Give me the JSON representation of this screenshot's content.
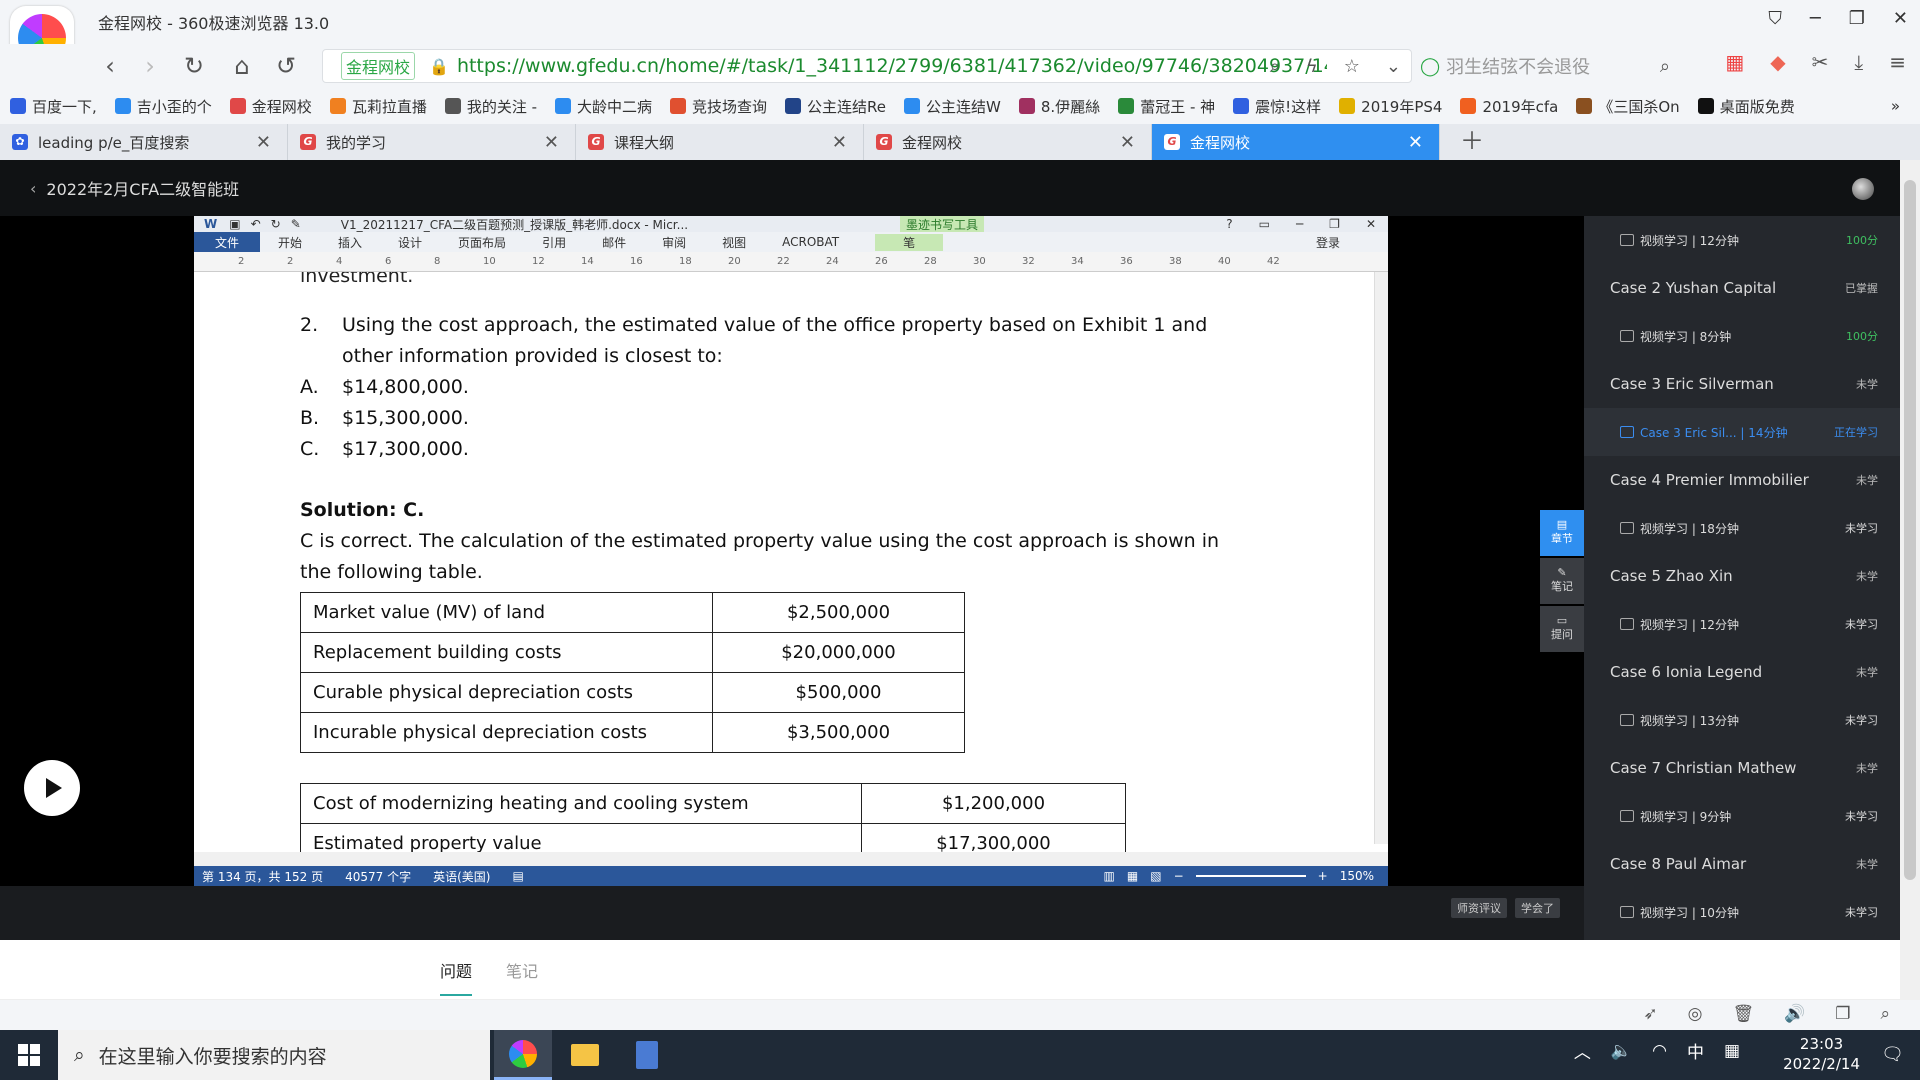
{
  "browser": {
    "window_title": "金程网校 - 360极速浏览器 13.0",
    "url_tag": "金程网校",
    "url": "https://www.gfedu.cn/home/#/task/1_341112/2799/6381/417362/video/97746/38204937/14",
    "search_placeholder": "羽生结弦不会退役",
    "bookmarks": [
      "百度一下,",
      "吉小歪的个",
      "金程网校",
      "瓦莉拉直播",
      "我的关注 -",
      "大龄中二病",
      "竞技场查询",
      "公主连结Re",
      "公主连结W",
      "8.伊麗絲",
      "蕾冠王 - 神",
      "震惊!这样",
      "2019年PS4",
      "2019年cfa",
      "《三国杀On",
      "桌面版免费"
    ],
    "tabs": [
      "leading p/e_百度搜索",
      "我的学习",
      "课程大纲",
      "金程网校",
      "金程网校"
    ]
  },
  "course": {
    "title": "2022年2月CFA二级智能班"
  },
  "word": {
    "title": "V1_20211217_CFA二级百题预测_授课版_韩老师.docx - Micr...",
    "draw_tools": "墨迹书写工具",
    "pen": "笔",
    "menu": [
      "文件",
      "开始",
      "插入",
      "设计",
      "页面布局",
      "引用",
      "邮件",
      "审阅",
      "视图",
      "ACROBAT"
    ],
    "login": "登录",
    "status_page": "第 134 页，共 152 页",
    "status_words": "40577 个字",
    "status_lang": "英语(美国)",
    "zoom": "150%",
    "ruler_nums": [
      "2",
      "2",
      "4",
      "6",
      "8",
      "10",
      "12",
      "14",
      "16",
      "18",
      "20",
      "22",
      "24",
      "26",
      "28",
      "30",
      "32",
      "34",
      "36",
      "38",
      "40",
      "42"
    ]
  },
  "doc": {
    "clip_top": "investment.",
    "q_num": "2.",
    "q_line1": "Using the cost approach, the estimated value of the office property based on Exhibit 1 and",
    "q_line2": "other information provided is closest to:",
    "options": [
      {
        "letter": "A.",
        "text": "$14,800,000."
      },
      {
        "letter": "B.",
        "text": "$15,300,000."
      },
      {
        "letter": "C.",
        "text": "$17,300,000."
      }
    ],
    "solution": "Solution: C.",
    "explain1": "C is correct. The calculation of the estimated property value using the cost approach is shown in",
    "explain2": "the following table.",
    "table1": [
      [
        "Market value (MV) of land",
        "$2,500,000"
      ],
      [
        "Replacement building costs",
        "$20,000,000"
      ],
      [
        "Curable physical depreciation costs",
        "$500,000"
      ],
      [
        "Incurable physical depreciation costs",
        "$3,500,000"
      ]
    ],
    "table2": [
      [
        "Cost of modernizing heating and cooling system",
        "$1,200,000"
      ],
      [
        "Estimated property value",
        "$17,300,000"
      ]
    ]
  },
  "sidebar": {
    "items": [
      {
        "type": "sub",
        "label": "视频学习 | 12分钟",
        "status": "100分",
        "color": "#3fbf60"
      },
      {
        "type": "case",
        "label": "Case 2 Yushan Capital",
        "status": "已掌握"
      },
      {
        "type": "sub",
        "label": "视频学习 | 8分钟",
        "status": "100分",
        "color": "#3fbf60"
      },
      {
        "type": "case",
        "label": "Case 3 Eric Silverman",
        "status": "未学"
      },
      {
        "type": "sub",
        "label": "Case 3 Eric Sil... | 14分钟",
        "status": "正在学习",
        "active": true
      },
      {
        "type": "case",
        "label": "Case 4 Premier Immobilier",
        "status": "未学"
      },
      {
        "type": "sub",
        "label": "视频学习 | 18分钟",
        "status": "未学习"
      },
      {
        "type": "case",
        "label": "Case 5 Zhao Xin",
        "status": "未学"
      },
      {
        "type": "sub",
        "label": "视频学习 | 12分钟",
        "status": "未学习"
      },
      {
        "type": "case",
        "label": "Case 6 Ionia Legend",
        "status": "未学"
      },
      {
        "type": "sub",
        "label": "视频学习 | 13分钟",
        "status": "未学习"
      },
      {
        "type": "case",
        "label": "Case 7 Christian Mathew",
        "status": "未学"
      },
      {
        "type": "sub",
        "label": "视频学习 | 9分钟",
        "status": "未学习"
      },
      {
        "type": "case",
        "label": "Case 8 Paul Aimar",
        "status": "未学"
      },
      {
        "type": "sub",
        "label": "视频学习 | 10分钟",
        "status": "未学习"
      }
    ],
    "side_tabs": [
      "章节",
      "笔记",
      "提问"
    ]
  },
  "controls": {
    "btn1": "师资评议",
    "btn2": "学会了"
  },
  "bottom_tabs": [
    "问题",
    "笔记"
  ],
  "taskbar": {
    "search": "在这里输入你要搜索的内容",
    "ime": "中",
    "time": "23:03",
    "date": "2022/2/14"
  },
  "colors": {
    "accent": "#2f8ff0",
    "url_green": "#1b8a2e",
    "word_blue": "#2b579a"
  }
}
